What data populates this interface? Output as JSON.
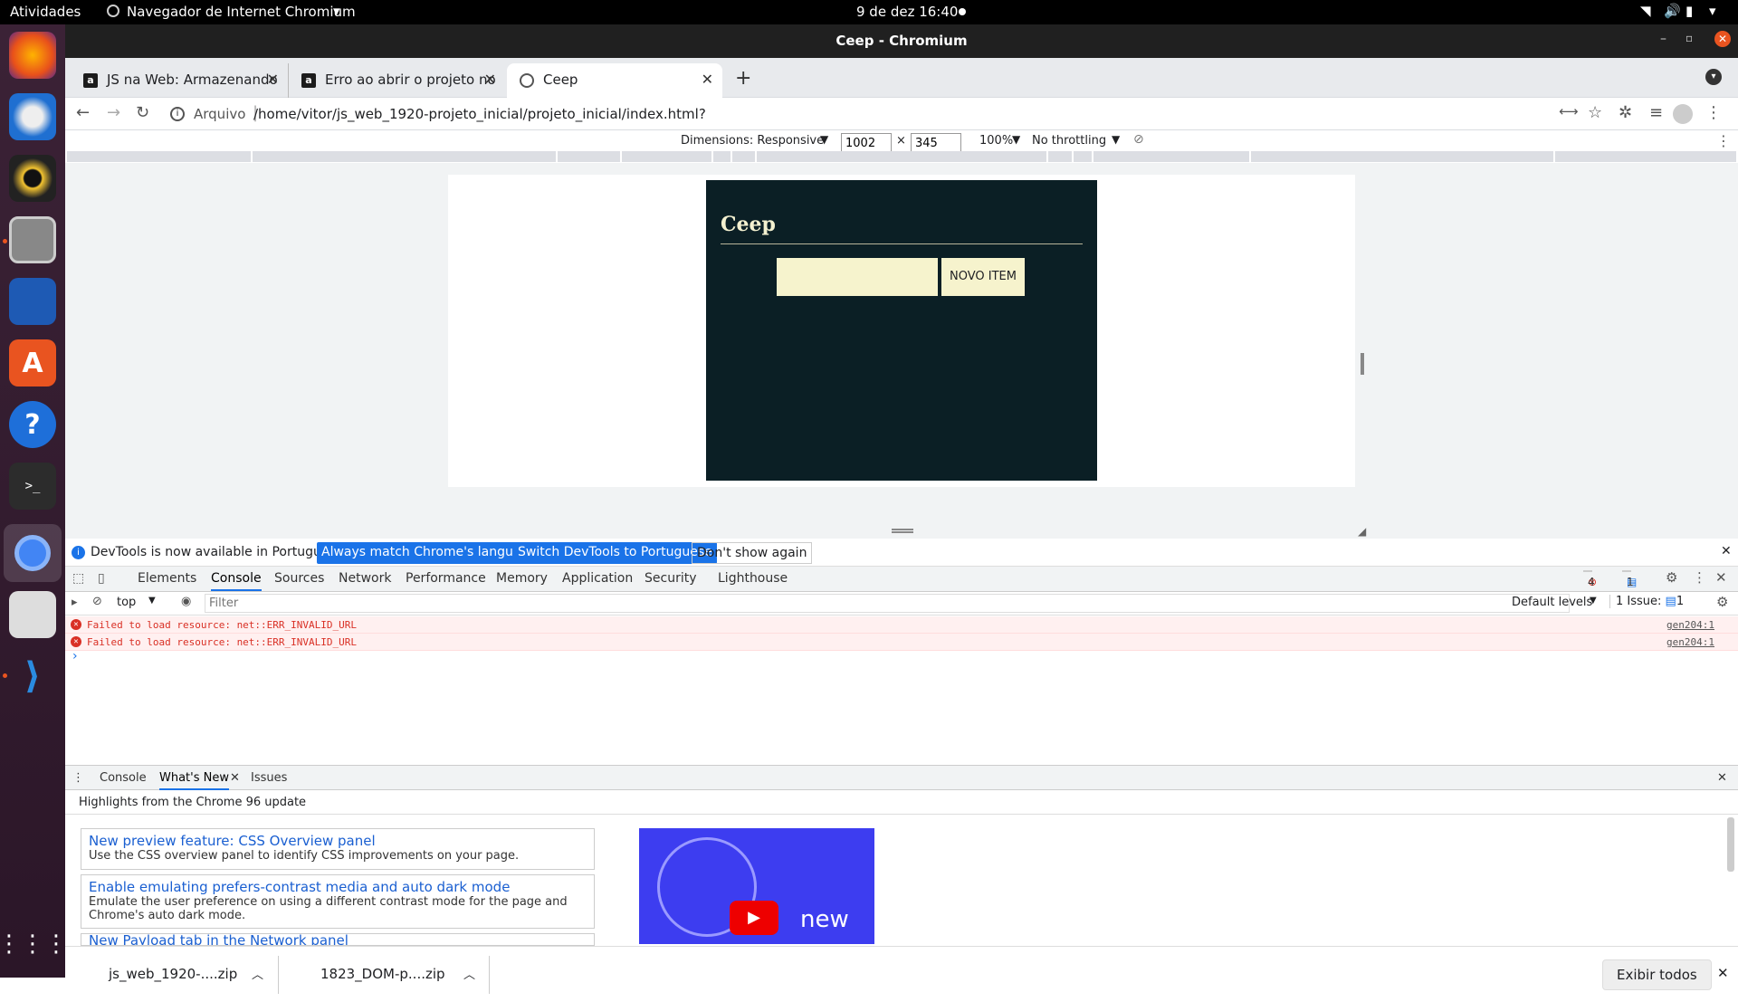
{
  "topbar": {
    "activities": "Atividades",
    "app_name": "Navegador de Internet Chromium",
    "clock": "9 de dez  16:40"
  },
  "window": {
    "title": "Ceep - Chromium"
  },
  "tabs": [
    {
      "favicon": "a",
      "label": "JS na Web: Armazenando",
      "active": false
    },
    {
      "favicon": "a",
      "label": "Erro ao abrir o projeto no",
      "active": false
    },
    {
      "favicon": "globe",
      "label": "Ceep",
      "active": true
    }
  ],
  "address": {
    "security_label": "Arquivo",
    "url": "/home/vitor/js_web_1920-projeto_inicial/projeto_inicial/index.html?"
  },
  "device_toolbar": {
    "dimensions_label": "Dimensions: Responsive",
    "width": "1002",
    "times": "×",
    "height": "345",
    "zoom": "100%",
    "throttling": "No throttling"
  },
  "page": {
    "logo": "Ceep",
    "button": "NOVO ITEM",
    "input_placeholder": ""
  },
  "infobar": {
    "message": "DevTools is now available in Portuguese!",
    "btn1": "Always match Chrome's language",
    "btn2": "Switch DevTools to Portuguese",
    "btn3": "Don't show again"
  },
  "devtools_tabs": [
    "Elements",
    "Console",
    "Sources",
    "Network",
    "Performance",
    "Memory",
    "Application",
    "Security",
    "Lighthouse"
  ],
  "devtools_counts": {
    "errors": "4",
    "messages": "1"
  },
  "console_toolbar": {
    "context": "top",
    "filter_placeholder": "Filter",
    "levels": "Default levels",
    "issues": "1 Issue:",
    "issues_count": "1"
  },
  "console_messages": [
    {
      "text": "Failed to load resource: net::ERR_INVALID_URL",
      "source": "gen204:1"
    },
    {
      "text": "Failed to load resource: net::ERR_INVALID_URL",
      "source": "gen204:1"
    }
  ],
  "console_prompt": "›",
  "drawer": {
    "tabs": [
      "Console",
      "What's New",
      "Issues"
    ],
    "subtitle": "Highlights from the Chrome 96 update"
  },
  "whatsnew": [
    {
      "title": "New preview feature: CSS Overview panel",
      "desc": "Use the CSS overview panel to identify CSS improvements on your page."
    },
    {
      "title": "Enable emulating prefers-contrast media and auto dark mode",
      "desc": "Emulate the user preference on using a different contrast mode for the page and Chrome's auto dark mode."
    },
    {
      "title": "New Payload tab in the Network panel",
      "desc": ""
    }
  ],
  "video_text": "new",
  "downloads": [
    {
      "name": "js_web_1920-....zip"
    },
    {
      "name": "1823_DOM-p....zip"
    }
  ],
  "show_all": "Exibir todos",
  "colors": {
    "app_bg": "#0b1f25",
    "app_field": "#f6f3cd",
    "accent": "#1a73e8",
    "error": "#d93025"
  }
}
